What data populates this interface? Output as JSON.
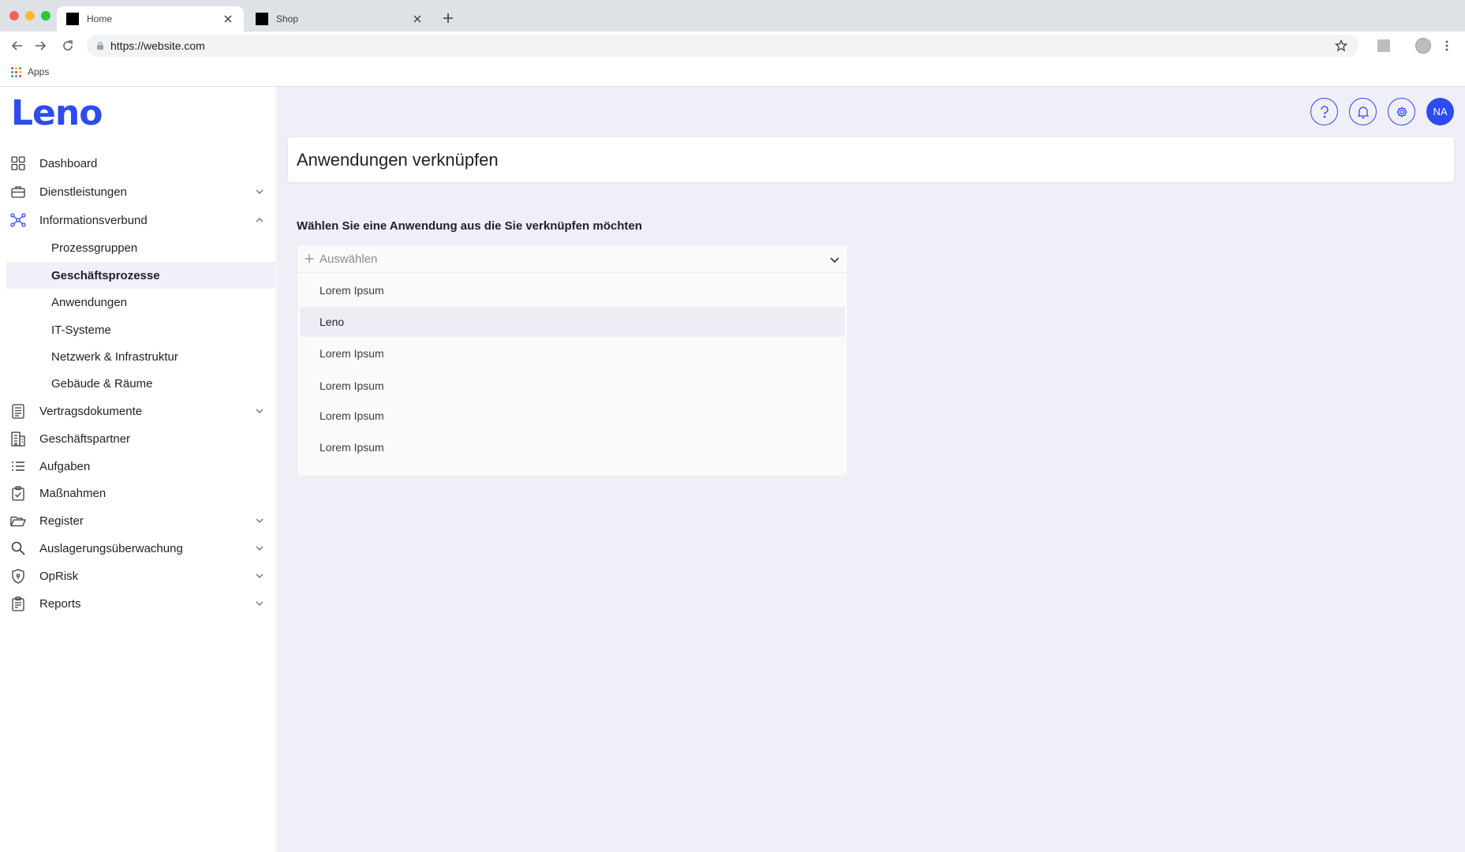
{
  "browser": {
    "tabs": [
      {
        "title": "Home",
        "active": true
      },
      {
        "title": "Shop",
        "active": false
      }
    ],
    "url": "https://website.com",
    "bookmarks": {
      "apps_label": "Apps"
    },
    "traffic_lights": {
      "close": "#ff5f57",
      "minimize": "#febc2e",
      "maximize": "#28c840"
    }
  },
  "app": {
    "logo": "Leno",
    "accent": "#2d4bf0",
    "sidebar": {
      "items": [
        {
          "label": "Dashboard",
          "icon": "dashboard-grid-icon",
          "expandable": false
        },
        {
          "label": "Dienstleistungen",
          "icon": "briefcase-icon",
          "expandable": true,
          "expanded": false
        },
        {
          "label": "Informationsverbund",
          "icon": "network-nodes-icon",
          "expandable": true,
          "expanded": true
        },
        {
          "label": "Vertragsdokumente",
          "icon": "document-icon",
          "expandable": true,
          "expanded": false
        },
        {
          "label": "Geschäftspartner",
          "icon": "building-icon",
          "expandable": false
        },
        {
          "label": "Aufgaben",
          "icon": "task-list-icon",
          "expandable": false
        },
        {
          "label": "Maßnahmen",
          "icon": "clipboard-check-icon",
          "expandable": false
        },
        {
          "label": "Register",
          "icon": "folder-icon",
          "expandable": true,
          "expanded": false
        },
        {
          "label": "Auslagerungsüberwachung",
          "icon": "magnifier-icon",
          "expandable": true,
          "expanded": false
        },
        {
          "label": "OpRisk",
          "icon": "shield-icon",
          "expandable": true,
          "expanded": false
        },
        {
          "label": "Reports",
          "icon": "report-clipboard-icon",
          "expandable": true,
          "expanded": false
        }
      ],
      "subitems": [
        {
          "label": "Prozessgruppen",
          "active": false
        },
        {
          "label": "Geschäftsprozesse",
          "active": true
        },
        {
          "label": "Anwendungen",
          "active": false
        },
        {
          "label": "IT-Systeme",
          "active": false
        },
        {
          "label": "Netzwerk & Infrastruktur",
          "active": false
        },
        {
          "label": "Gebäude & Räume",
          "active": false
        }
      ]
    },
    "header": {
      "avatar_initials": "NA",
      "icons": [
        "help-icon",
        "bell-icon",
        "gear-icon"
      ]
    },
    "page": {
      "title": "Anwendungen verknüpfen",
      "prompt": "Wählen Sie eine Anwendung aus die Sie verknüpfen möchten",
      "select": {
        "placeholder": "Auswählen",
        "options": [
          "Lorem Ipsum",
          "Leno",
          "Lorem Ipsum",
          "Lorem Ipsum",
          "Lorem Ipsum",
          "Lorem Ipsum"
        ],
        "highlighted_index": 1
      }
    }
  }
}
